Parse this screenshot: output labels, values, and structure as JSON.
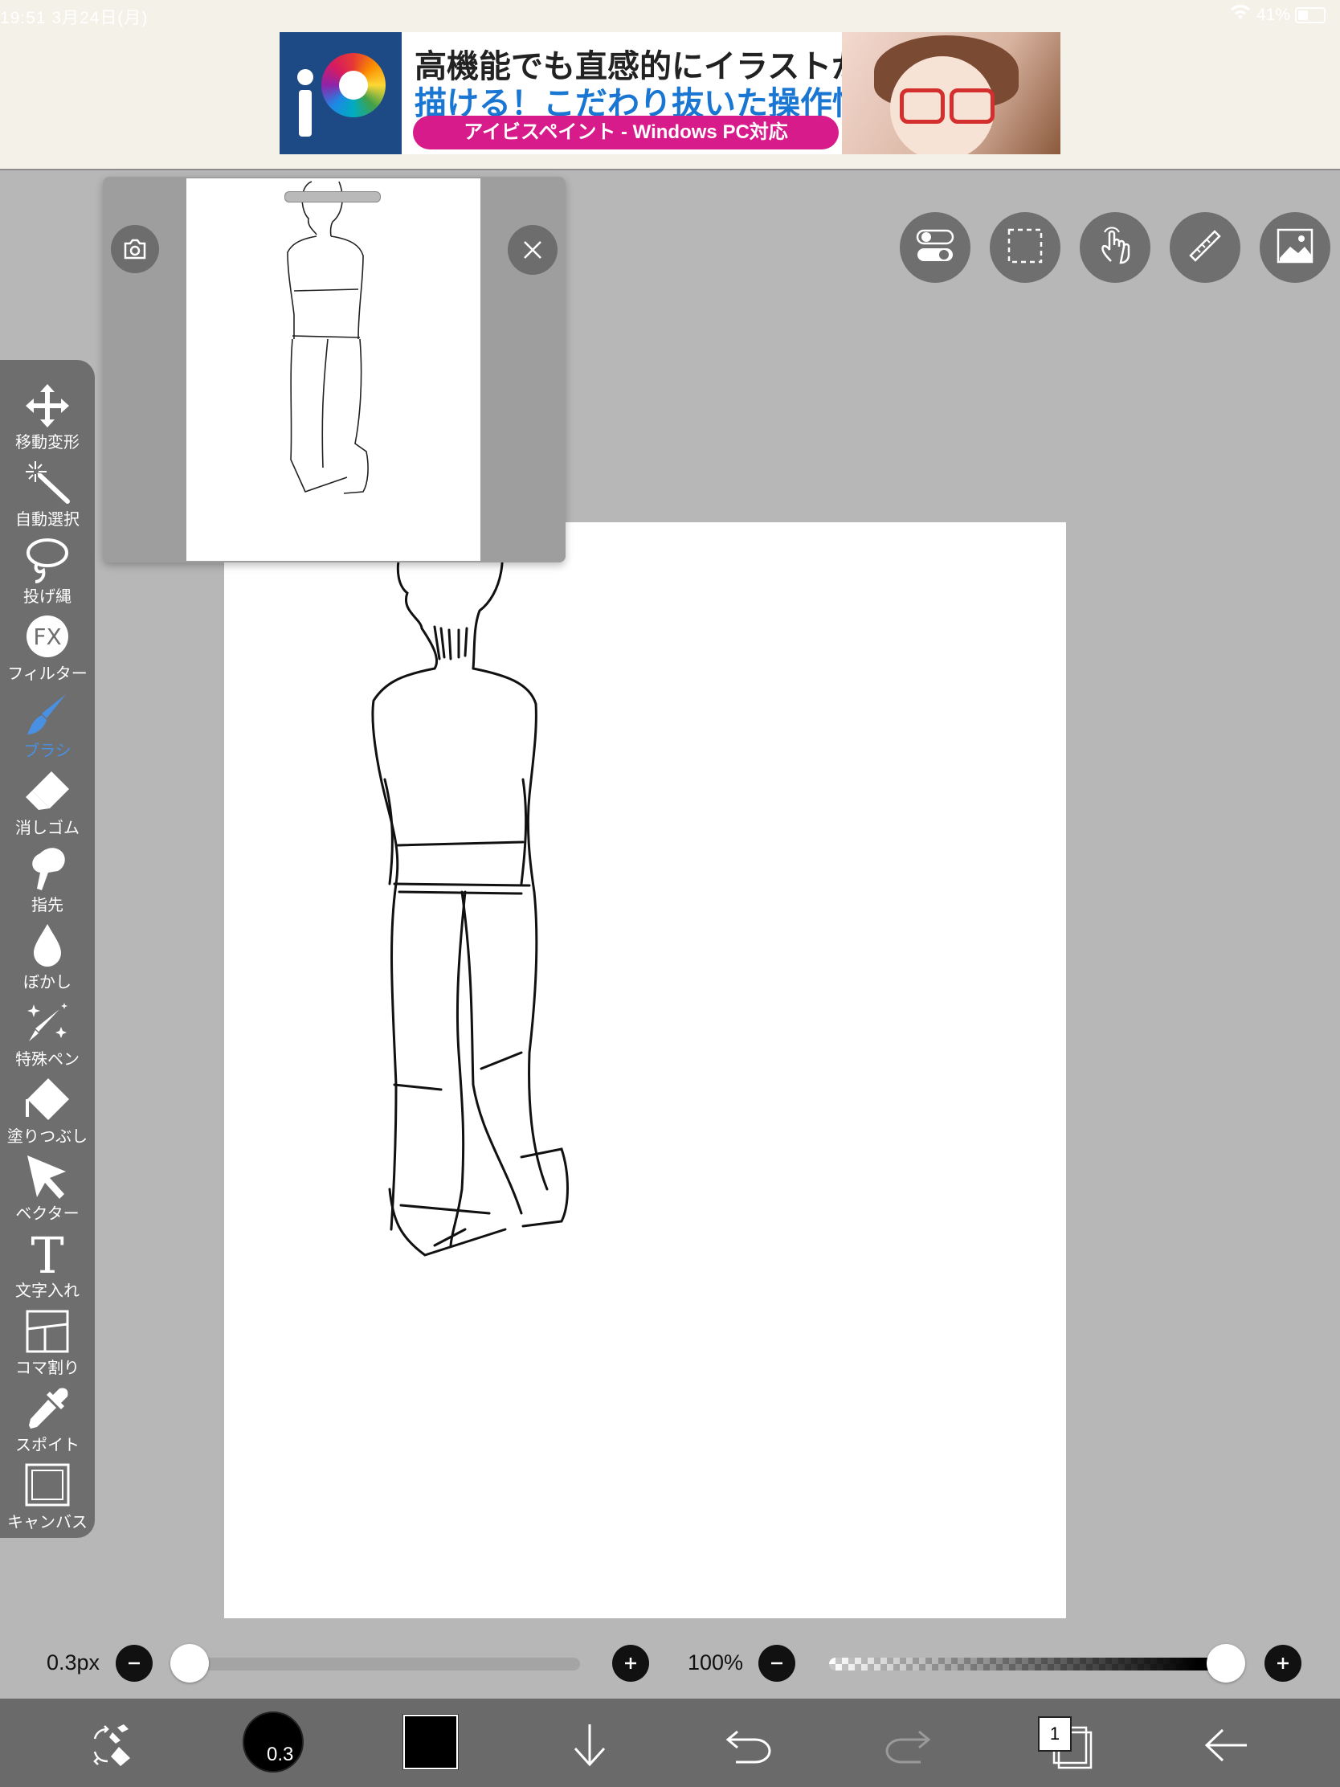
{
  "status": {
    "time": "19:51  3月24日(月)",
    "battery": "41%"
  },
  "ad": {
    "line1": "高機能でも直感的にイラストが",
    "line2": "描ける！こだわり抜いた操作性！",
    "pill": "アイビスペイント - Windows PC対応"
  },
  "tools": [
    {
      "label": "移動変形",
      "icon": "move-arrows-icon"
    },
    {
      "label": "自動選択",
      "icon": "magic-wand-icon"
    },
    {
      "label": "投げ縄",
      "icon": "lasso-icon"
    },
    {
      "label": "フィルター",
      "icon": "fx-icon"
    },
    {
      "label": "ブラシ",
      "icon": "brush-icon",
      "active": true
    },
    {
      "label": "消しゴム",
      "icon": "eraser-icon"
    },
    {
      "label": "指先",
      "icon": "finger-icon"
    },
    {
      "label": "ぼかし",
      "icon": "drop-icon"
    },
    {
      "label": "特殊ペン",
      "icon": "sparkle-pen-icon"
    },
    {
      "label": "塗りつぶし",
      "icon": "fill-bucket-icon"
    },
    {
      "label": "ベクター",
      "icon": "vector-arrow-icon"
    },
    {
      "label": "文字入れ",
      "icon": "text-T-icon"
    },
    {
      "label": "コマ割り",
      "icon": "frame-divider-icon"
    },
    {
      "label": "スポイト",
      "icon": "eyedropper-icon"
    },
    {
      "label": "キャンバス",
      "icon": "canvas-icon"
    }
  ],
  "sliders": {
    "brush_size_label": "0.3px",
    "brush_size_fraction": 0.0,
    "opacity_label": "100%",
    "opacity_fraction": 1.0
  },
  "bottombar": {
    "brush_size_badge": "0.3",
    "layer_count": "1",
    "color": "#000000"
  }
}
